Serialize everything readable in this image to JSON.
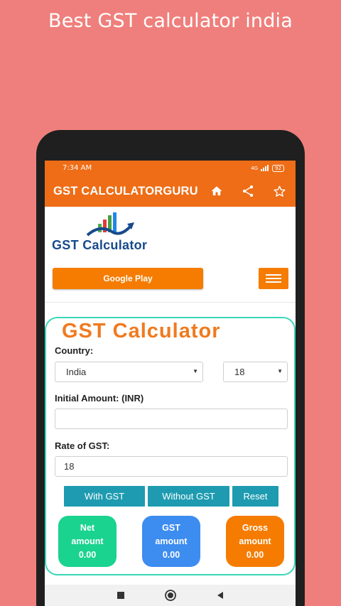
{
  "promo": {
    "title": "Best GST calculator india"
  },
  "status_bar": {
    "time": "7:34 AM",
    "signal": "4G",
    "battery": "92"
  },
  "app_bar": {
    "title": "GST CALCULATORGURU",
    "icons": [
      "home-icon",
      "share-icon",
      "star-icon"
    ]
  },
  "logo": {
    "text": "GST Calculator"
  },
  "cta": {
    "google_play_label": "Google Play"
  },
  "calculator": {
    "heading": "GST Calculator",
    "country_label": "Country:",
    "country_value": "India",
    "rate_select_value": "18",
    "initial_amount_label": "Initial Amount:  (INR)",
    "initial_amount_value": "",
    "rate_label": "Rate of GST:",
    "rate_value": "18",
    "buttons": {
      "with_gst": "With GST",
      "without_gst": "Without GST",
      "reset": "Reset"
    },
    "results": {
      "net": {
        "line1": "Net",
        "line2": "amount",
        "value": "0.00",
        "color": "#19d38f"
      },
      "gst": {
        "line1": "GST",
        "line2": "amount",
        "value": "0.00",
        "color": "#3d8cf0"
      },
      "gross": {
        "line1": "Gross",
        "line2": "amount",
        "value": "0.00",
        "color": "#f57c00"
      }
    }
  },
  "colors": {
    "background": "#ef7f7c",
    "brand": "#ee6d16",
    "accent": "#1e9bb0",
    "card_border": "#38d6b8"
  }
}
